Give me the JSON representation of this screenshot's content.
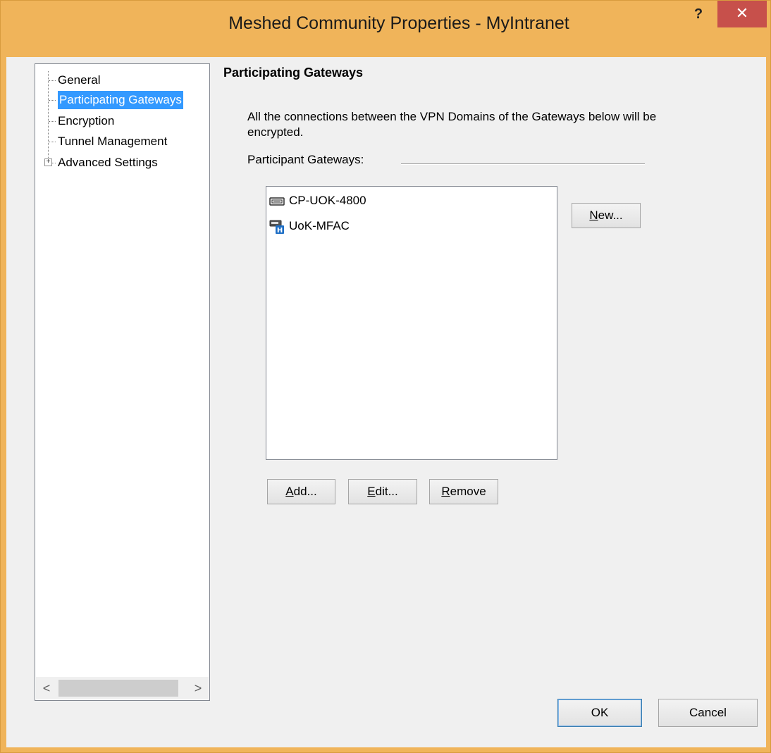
{
  "window": {
    "title": "Meshed Community Properties - MyIntranet",
    "help_label": "?",
    "close_label": "✕"
  },
  "tree": {
    "items": [
      {
        "label": "General",
        "selected": false
      },
      {
        "label": "Participating Gateways",
        "selected": true
      },
      {
        "label": "Encryption",
        "selected": false
      },
      {
        "label": "Tunnel Management",
        "selected": false
      },
      {
        "label": "Advanced Settings",
        "selected": false,
        "expandable": true
      }
    ],
    "expander_symbol": "+",
    "scroll_left": "<",
    "scroll_right": ">"
  },
  "panel": {
    "title": "Participating Gateways",
    "description": "All the connections between the VPN Domains of the Gateways below will be encrypted.",
    "group_label": "Participant Gateways:"
  },
  "gateways": [
    {
      "name": "CP-UOK-4800",
      "icon": "gateway-appliance-icon"
    },
    {
      "name": "UoK-MFAC",
      "icon": "gateway-cluster-icon"
    }
  ],
  "buttons": {
    "new": {
      "mnemonic": "N",
      "rest": "ew..."
    },
    "add": {
      "mnemonic": "A",
      "rest": "dd..."
    },
    "edit": {
      "mnemonic": "E",
      "rest": "dit..."
    },
    "remove": {
      "mnemonic": "R",
      "rest": "emove"
    },
    "ok": "OK",
    "cancel": "Cancel"
  },
  "colors": {
    "title_bar": "#f0b45a",
    "close_button": "#c7504b",
    "selection": "#3399ff"
  }
}
